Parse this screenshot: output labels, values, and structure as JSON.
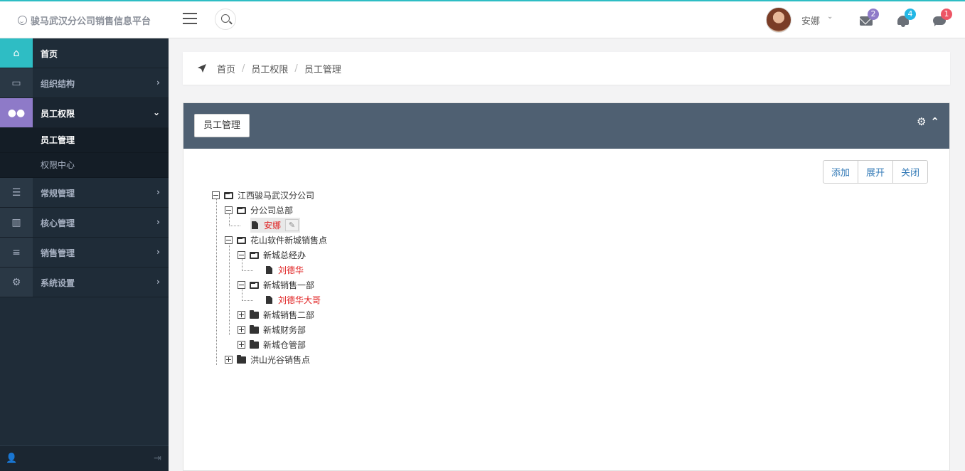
{
  "app": {
    "title": "骏马武汉分公司销售信息平台"
  },
  "header": {
    "user_name": "安娜",
    "badges": {
      "messages": "2",
      "notifications": "4",
      "chats": "1"
    },
    "badge_colors": {
      "messages": "#8e7ac8",
      "notifications": "#23b7e5",
      "chats": "#ed5565"
    }
  },
  "sidebar": {
    "items": [
      {
        "label": "首页",
        "icon": "home-icon"
      },
      {
        "label": "组织结构",
        "icon": "desktop-icon"
      },
      {
        "label": "员工权限",
        "icon": "users-icon"
      },
      {
        "label": "常规管理",
        "icon": "list-alt-icon"
      },
      {
        "label": "核心管理",
        "icon": "bar-chart-icon"
      },
      {
        "label": "销售管理",
        "icon": "list-icon"
      },
      {
        "label": "系统设置",
        "icon": "cogs-icon"
      }
    ],
    "submenu": [
      {
        "label": "员工管理"
      },
      {
        "label": "权限中心"
      }
    ]
  },
  "breadcrumb": [
    "首页",
    "员工权限",
    "员工管理"
  ],
  "panel": {
    "title": "员工管理",
    "buttons": {
      "add": "添加",
      "expand": "展开",
      "close": "关闭"
    }
  },
  "tree": [
    {
      "label": "江西骏马武汉分公司",
      "type": "folder-open",
      "toggle": "minus"
    },
    {
      "label": "分公司总部",
      "type": "folder-open",
      "toggle": "minus"
    },
    {
      "label": "安娜",
      "type": "file",
      "red": true
    },
    {
      "label": "花山软件新城销售点",
      "type": "folder-open",
      "toggle": "minus"
    },
    {
      "label": "新城总经办",
      "type": "folder-open",
      "toggle": "minus"
    },
    {
      "label": "刘德华",
      "type": "file",
      "red": true
    },
    {
      "label": "新城销售一部",
      "type": "folder-open",
      "toggle": "minus"
    },
    {
      "label": "刘德华大哥",
      "type": "file",
      "red": true
    },
    {
      "label": "新城销售二部",
      "type": "folder",
      "toggle": "plus"
    },
    {
      "label": "新城财务部",
      "type": "folder",
      "toggle": "plus"
    },
    {
      "label": "新城仓管部",
      "type": "folder",
      "toggle": "plus"
    },
    {
      "label": "洪山光谷销售点",
      "type": "folder",
      "toggle": "plus"
    }
  ]
}
